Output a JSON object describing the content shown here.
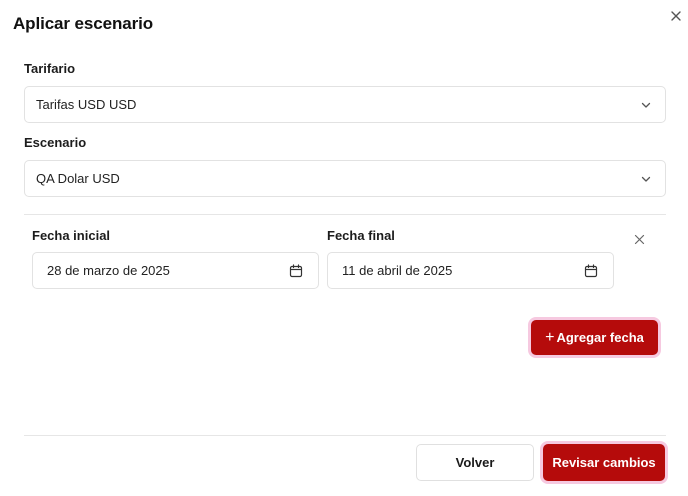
{
  "dialog": {
    "title": "Aplicar escenario",
    "close_icon": "close-icon"
  },
  "tarifario": {
    "label": "Tarifario",
    "value": "Tarifas USD USD",
    "icon": "chevron-down-icon"
  },
  "escenario": {
    "label": "Escenario",
    "value": "QA Dolar USD",
    "icon": "chevron-down-icon"
  },
  "date_range": {
    "start_label": "Fecha inicial",
    "start_value": "28 de marzo de 2025",
    "end_label": "Fecha final",
    "end_value": "11 de abril de 2025",
    "calendar_icon": "calendar-icon",
    "remove_icon": "close-icon"
  },
  "actions": {
    "add_date_label": "Agregar fecha",
    "add_date_prefix": "+",
    "back_label": "Volver",
    "review_label": "Revisar cambios"
  },
  "colors": {
    "primary": "#b50b0b",
    "focus_ring": "#f6c9e0",
    "border": "#e2e2e2"
  }
}
